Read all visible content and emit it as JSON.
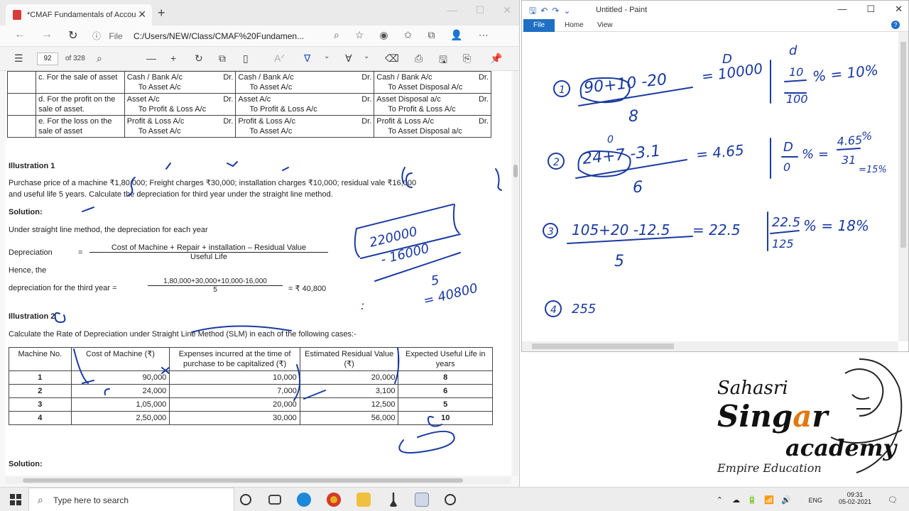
{
  "browser": {
    "tab_title": "*CMAF Fundamentals of Accou",
    "tab_close": "✕",
    "new_tab": "+",
    "window_controls": [
      "—",
      "☐",
      "✕"
    ],
    "nav": [
      "←",
      "→",
      "↻"
    ],
    "url_info": "ⓘ",
    "url_scheme": "File",
    "url": "C:/Users/NEW/Class/CMAF%20Fundamen...",
    "address_icons": [
      "⌕",
      "☆",
      "◉",
      "✩",
      "⧉",
      "👤",
      "⋯"
    ]
  },
  "pdf_toolbar": {
    "contents_icon": "☰",
    "page_value": "92",
    "page_total": "of 328",
    "icons": [
      "⌕",
      "—",
      "+",
      "↻",
      "⧉",
      "▯",
      "Aᐟ",
      "∇",
      "⌄",
      "∀",
      "⌄",
      "⌫",
      "⎙",
      "🖫",
      "⎘",
      "📌"
    ]
  },
  "pdf": {
    "table1_rows": [
      {
        "c0": "",
        "c1": "c. For the sale of asset",
        "c2_line1": "Cash / Bank A/c",
        "c2_dr": "Dr.",
        "c2_line2": "To Asset A/c",
        "c3_line1": "Cash / Bank A/c",
        "c3_dr": "Dr.",
        "c3_line2": "To Asset A/c",
        "c4_line1": "Cash / Bank A/c",
        "c4_dr": "Dr.",
        "c4_line2": "To Asset Disposal A/c"
      },
      {
        "c0": "",
        "c1": "d. For the profit on the sale of asset.",
        "c2_line1": "Asset A/c",
        "c2_dr": "Dr.",
        "c2_line2": "To Profit & Loss A/c",
        "c3_line1": "Asset A/c",
        "c3_dr": "Dr.",
        "c3_line2": "To Profit & Loss A/c",
        "c4_line1": "Asset Disposal a/c",
        "c4_dr": "Dr.",
        "c4_line2": "To Profit & Loss A/c"
      },
      {
        "c0": "",
        "c1": "e. For the loss on the sale of asset",
        "c2_line1": "Profit & Loss A/c",
        "c2_dr": "Dr.",
        "c2_line2": "To Asset A/c",
        "c3_line1": "Profit & Loss A/c",
        "c3_dr": "Dr.",
        "c3_line2": "To Asset A/c",
        "c4_line1": "Profit & Loss A/c",
        "c4_dr": "Dr.",
        "c4_line2": "To Asset Disposal a/c"
      }
    ],
    "illus1_title": "Illustration 1",
    "illus1_text1": "Purchase price of a machine ₹1,80,000; Freight charges ₹30,000; installation charges ₹10,000; residual vale ₹16,000",
    "illus1_text2": "and useful life 5 years. Calculate the depreciation for third year under the straight line method.",
    "solution1": "Solution:",
    "under_slm": "Under straight line method, the depreciation for each year",
    "depreciation_label": "Depreciation",
    "equals": "=",
    "formula_num": "Cost of Machine + Repair + installation – Residual Value",
    "formula_den": "Useful Life",
    "hence": "Hence, the",
    "third_year": "depreciation for the third year =",
    "calc_num": "1,80,000+30,000+10,000-16,000",
    "calc_den": "5",
    "result": "= ₹ 40,800",
    "illus2_title": "Illustration 2",
    "illus2_text": "Calculate the Rate of Depreciation under Straight Line Method (SLM) in each of the following cases:-",
    "table2_headers": [
      "Machine No.",
      "Cost of Machine (₹)",
      "Expenses incurred at the time of purchase to be capitalized (₹)",
      "Estimated Residual Value (₹)",
      "Expected Useful Life in years"
    ],
    "table2_rows": [
      [
        "1",
        "90,000",
        "10,000",
        "20,000",
        "8"
      ],
      [
        "2",
        "24,000",
        "7,000",
        "3,100",
        "6"
      ],
      [
        "3",
        "1,05,000",
        "20,000",
        "12,500",
        "5"
      ],
      [
        "4",
        "2,50,000",
        "30,000",
        "56,000",
        "10"
      ]
    ],
    "solution2": "Solution:"
  },
  "handwriting_left": {
    "box_line1": "220000",
    "box_line2": "- 16000",
    "div": "5",
    "result": "= 40800",
    "colon": ":"
  },
  "paint": {
    "title": "Untitled - Paint",
    "quick_access": "🖫↶↷⌄",
    "window_controls": [
      "—",
      "☐",
      "✕"
    ],
    "ribbon_tabs": [
      "File",
      "Home",
      "View"
    ],
    "help": "?",
    "notes": {
      "n1_label": "1",
      "n1_expr": "90+10 -20",
      "n1_den": "8",
      "n1_mid": "= 10000",
      "n1_D": "D",
      "n1_frac_num": "d",
      "n1_frac_a": "10",
      "n1_frac_b": "100",
      "n1_pct": "% = 10%",
      "n2_label": "2",
      "n2_expr": "24+7 -3.1",
      "n2_den": "6",
      "n2_mid": "= 4.65",
      "n2_zero": "0",
      "n2_frac_num": "D",
      "n2_frac_den": "0",
      "n2_pct": "% =",
      "n2_frac2_num": "4.65",
      "n2_frac2_den": "31",
      "n2_pct2": "%",
      "n2_result": "=15%",
      "n3_label": "3",
      "n3_expr": "105+20 -12.5",
      "n3_den": "5",
      "n3_mid": "= 22.5",
      "n3_frac_num": "22.5",
      "n3_frac_den": "125",
      "n3_pct": "% = 18%",
      "n4_label": "4",
      "n4_expr": "255"
    }
  },
  "logo": {
    "line1": "Sahasri",
    "line2_a": "Sing",
    "line2_b": "a",
    "line2_c": "r",
    "line3": "academy",
    "line4": "Empire Education"
  },
  "taskbar": {
    "search_icon": "⌕",
    "search_placeholder": "Type here to search",
    "time": "09:31",
    "date": "05-02-2021",
    "lang": "ENG",
    "tray_symbols": [
      "⌃",
      "☁",
      "🔋",
      "📶",
      "🔊"
    ],
    "notify": "🗨"
  },
  "colors": {
    "ink_blue": "#1a3aa0",
    "paint_file_tab": "#1f6fc5",
    "logo_accent": "#e07a10"
  }
}
